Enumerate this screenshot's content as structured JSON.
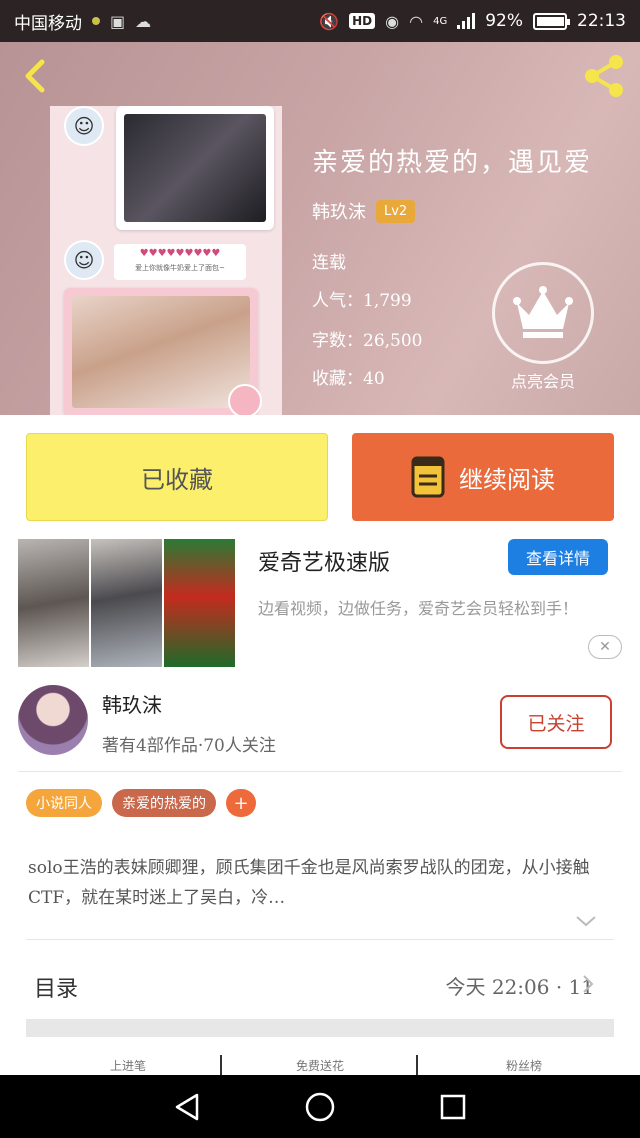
{
  "status_bar": {
    "carrier": "中国移动",
    "network": "4G",
    "battery": "92%",
    "time": "22:13"
  },
  "book": {
    "title": "亲爱的热爱的，遇见爱",
    "author": "韩玖沫",
    "level": "Lv2",
    "state": "连载",
    "popularity_label": "人气：1,799",
    "word_count_label": "字数：26,500",
    "favorites_label": "收藏：40"
  },
  "vip": {
    "label": "点亮会员"
  },
  "cover": {
    "chat_text": "爱上你就像牛奶爱上了面包~"
  },
  "actions": {
    "collected_label": "已收藏",
    "continue_label": "继续阅读"
  },
  "ad": {
    "title": "爱奇艺极速版",
    "detail_button": "查看详情",
    "description": "边看视频，边做任务，爱奇艺会员轻松到手！"
  },
  "author_card": {
    "name": "韩玖沫",
    "meta": "著有4部作品·70人关注",
    "follow_label": "已关注"
  },
  "tags": [
    "小说同人",
    "亲爱的热爱的"
  ],
  "tag_add": "+",
  "synopsis": "solo王浩的表妹顾卿狸，顾氏集团千金也是风尚索罗战队的团宠，从小接触CTF，就在某时迷上了吴白，冷…",
  "toc": {
    "label": "目录",
    "updated": "今天 22:06 · 11"
  },
  "bottom_tabs": {
    "left": "上进笔",
    "middle": "免费送花",
    "right": "粉丝榜"
  },
  "colors": {
    "accent_orange": "#ea6a3c",
    "collected_yellow": "#fbef6c",
    "follow_red": "#c8402e",
    "ad_blue": "#1e7fe3"
  }
}
